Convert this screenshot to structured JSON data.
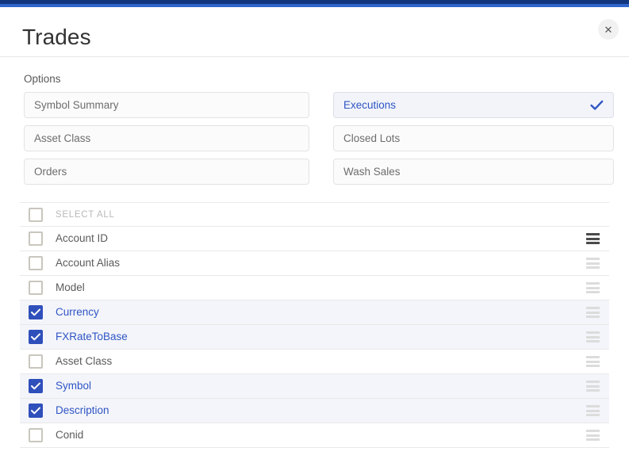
{
  "window": {
    "accent_dark": "#12367e",
    "accent_light": "#3066cc"
  },
  "header": {
    "title": "Trades",
    "close_label": "✕"
  },
  "options": {
    "label": "Options",
    "items": [
      {
        "label": "Symbol Summary",
        "selected": false,
        "column": "left"
      },
      {
        "label": "Executions",
        "selected": true,
        "column": "right"
      },
      {
        "label": "Asset Class",
        "selected": false,
        "column": "left"
      },
      {
        "label": "Closed Lots",
        "selected": false,
        "column": "right"
      },
      {
        "label": "Orders",
        "selected": false,
        "column": "left"
      },
      {
        "label": "Wash Sales",
        "selected": false,
        "column": "right"
      }
    ],
    "selected_color": "#2f55c4",
    "check_color": "#2f55c4"
  },
  "column_list": {
    "select_all_label": "SELECT ALL",
    "select_all_checked": false,
    "rows": [
      {
        "label": "Account ID",
        "checked": false,
        "handle": "active"
      },
      {
        "label": "Account Alias",
        "checked": false,
        "handle": "normal"
      },
      {
        "label": "Model",
        "checked": false,
        "handle": "normal"
      },
      {
        "label": "Currency",
        "checked": true,
        "handle": "normal"
      },
      {
        "label": "FXRateToBase",
        "checked": true,
        "handle": "normal"
      },
      {
        "label": "Asset Class",
        "checked": false,
        "handle": "normal"
      },
      {
        "label": "Symbol",
        "checked": true,
        "handle": "normal"
      },
      {
        "label": "Description",
        "checked": true,
        "handle": "normal"
      },
      {
        "label": "Conid",
        "checked": false,
        "handle": "normal"
      }
    ],
    "checked_color": "#2f4fbb",
    "row_selected_bg": "#f4f5fa"
  }
}
